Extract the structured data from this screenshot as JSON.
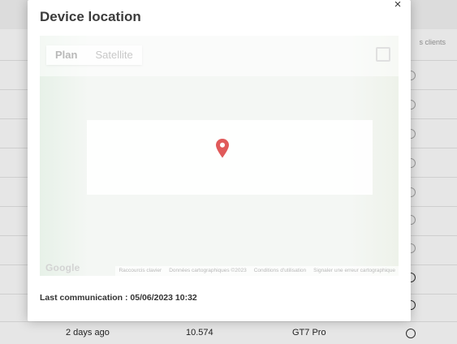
{
  "modal": {
    "title": "Device location",
    "close_icon": "×",
    "last_communication": "Last communication : 05/06/2023 10:32"
  },
  "map": {
    "type_buttons": [
      "Plan",
      "Satellite"
    ],
    "google_logo": "Google",
    "footer_links": [
      "Raccourcis clavier",
      "Données cartographiques ©2023",
      "Conditions d'utilisation",
      "Signaler une erreur cartographique"
    ],
    "marker_color": "#e05a5a",
    "marker_icon": "map-pin-icon",
    "fullscreen_icon": "fullscreen-icon"
  },
  "background": {
    "column_header": "s clients",
    "last_row": {
      "time": "2 days ago",
      "value": "10.574",
      "model": "GT7 Pro"
    }
  }
}
